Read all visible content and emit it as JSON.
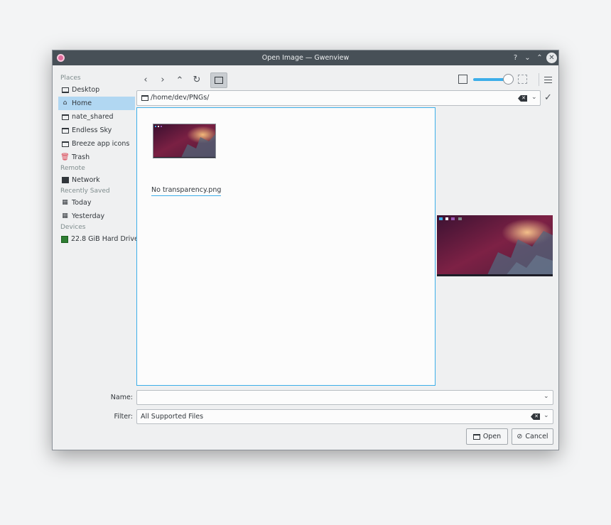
{
  "window": {
    "title": "Open Image — Gwenview",
    "help": "?",
    "minimize": "⌄",
    "maximize": "⌃",
    "close": "✕"
  },
  "sidebar": {
    "sections": [
      {
        "title": "Places",
        "items": [
          {
            "label": "Desktop",
            "icon": "desktop-icon"
          },
          {
            "label": "Home",
            "icon": "home-icon",
            "active": true
          },
          {
            "label": "nate_shared",
            "icon": "folder-icon"
          },
          {
            "label": "Endless Sky",
            "icon": "folder-icon"
          },
          {
            "label": "Breeze app icons",
            "icon": "folder-icon"
          },
          {
            "label": "Trash",
            "icon": "trash-icon"
          }
        ]
      },
      {
        "title": "Remote",
        "items": [
          {
            "label": "Network",
            "icon": "network-icon"
          }
        ]
      },
      {
        "title": "Recently Saved",
        "items": [
          {
            "label": "Today",
            "icon": "calendar-icon"
          },
          {
            "label": "Yesterday",
            "icon": "calendar-icon"
          }
        ]
      },
      {
        "title": "Devices",
        "items": [
          {
            "label": "22.8 GiB Hard Drive",
            "icon": "drive-icon"
          }
        ]
      }
    ]
  },
  "toolbar": {
    "back": "‹",
    "forward": "›",
    "up": "⌃",
    "reload": "↻",
    "zoom_level_fraction": 0.85
  },
  "path": {
    "value": "/home/dev/PNGs/"
  },
  "files": [
    {
      "name": "No transparency.png"
    }
  ],
  "form": {
    "name_label": "Name:",
    "name_value": "",
    "filter_label": "Filter:",
    "filter_value": "All Supported Files"
  },
  "buttons": {
    "open": "Open",
    "cancel": "Cancel"
  },
  "colors": {
    "accent": "#3daee9",
    "selection": "#b1d7f2",
    "titlebar": "#475057"
  }
}
